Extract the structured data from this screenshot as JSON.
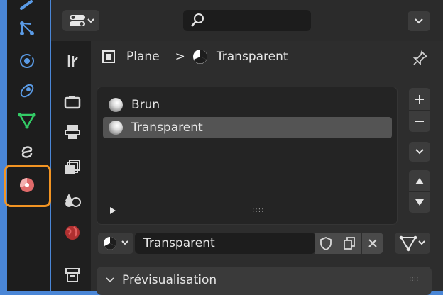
{
  "colors": {
    "background_blue": "#4a86d6",
    "highlight_orange": "#f29423",
    "dark_panel": "#2d2d2d"
  },
  "strip_icons": [
    "wrench-blue-icon",
    "particles-icon",
    "physics-icon",
    "constraints-icon",
    "object-data-icon",
    "curve-icon",
    "material-icon"
  ],
  "header": {
    "search_placeholder": ""
  },
  "breadcrumb": {
    "object": "Plane",
    "separator": ">",
    "material": "Transparent"
  },
  "material_slots": {
    "items": [
      {
        "label": "Brun",
        "selected": false
      },
      {
        "label": "Transparent",
        "selected": true
      }
    ],
    "grip": "::::"
  },
  "datablock": {
    "name": "Transparent"
  },
  "preview_panel": {
    "title": "Prévisualisation",
    "grip": "::::"
  }
}
